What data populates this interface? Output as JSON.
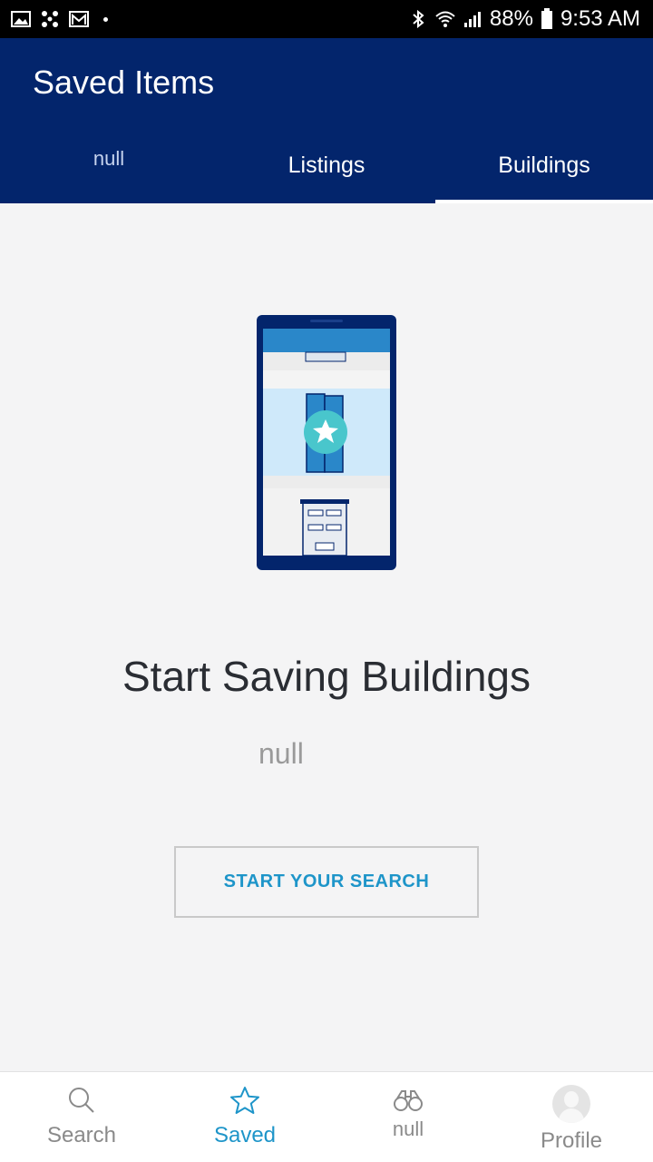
{
  "status_bar": {
    "battery": "88%",
    "time": "9:53 AM",
    "icons": [
      "image-icon",
      "fan-icon",
      "mail-icon",
      "bluetooth-icon",
      "wifi-icon",
      "signal-icon",
      "battery-icon"
    ]
  },
  "header": {
    "title": "Saved Items",
    "tabs": [
      {
        "label": "null"
      },
      {
        "label": "Listings"
      },
      {
        "label": "Buildings"
      }
    ]
  },
  "empty_state": {
    "headline": "Start Saving Buildings",
    "subtext": "null",
    "cta_label": "START YOUR SEARCH"
  },
  "bottom_nav": {
    "items": [
      {
        "label": "Search",
        "icon": "search-icon"
      },
      {
        "label": "Saved",
        "icon": "star-icon"
      },
      {
        "label": "null",
        "icon": "binoculars-icon"
      },
      {
        "label": "Profile",
        "icon": "avatar-icon"
      }
    ]
  },
  "colors": {
    "header_bg": "#03256c",
    "accent": "#1e95c9",
    "background": "#f4f4f5"
  }
}
